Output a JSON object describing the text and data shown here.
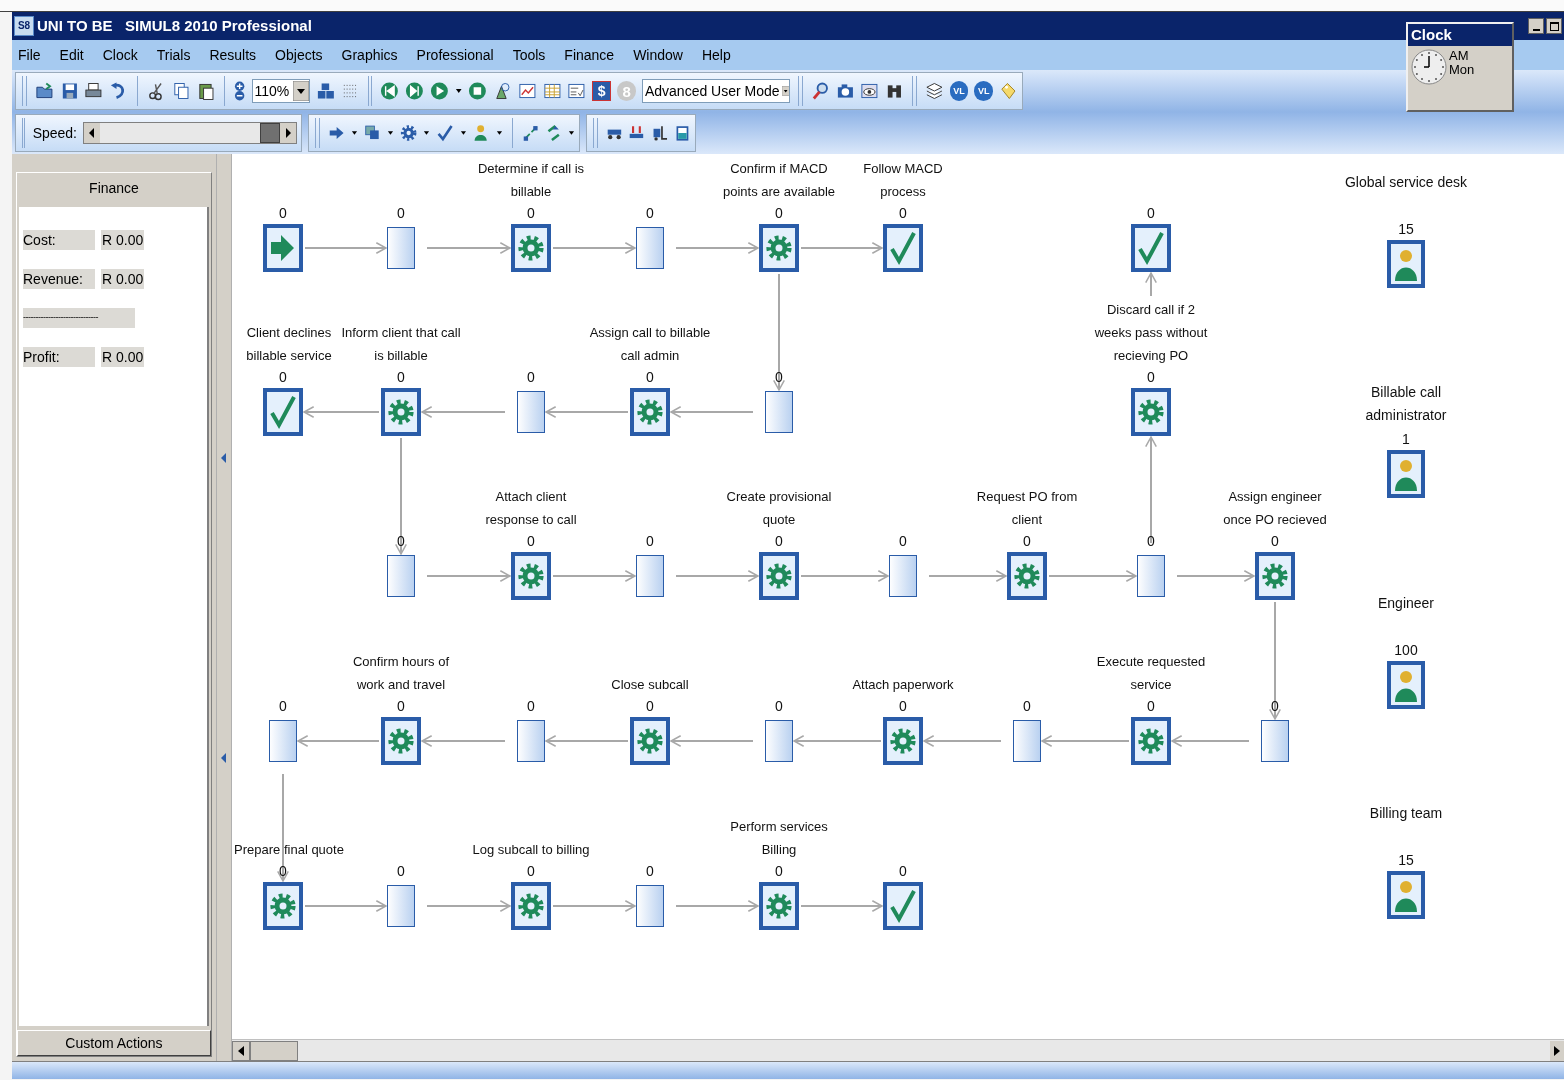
{
  "window": {
    "app_icon": "S8",
    "title": "UNI TO BE   SIMUL8 2010 Professional"
  },
  "menu": [
    "File",
    "Edit",
    "Clock",
    "Trials",
    "Results",
    "Objects",
    "Graphics",
    "Professional",
    "Tools",
    "Finance",
    "Window",
    "Help"
  ],
  "toolbar": {
    "zoom": "110%",
    "dollar_glyph": "$",
    "eight_glyph": "8",
    "mode": "Advanced User Mode",
    "vl_glyphs": [
      "VL",
      "VL"
    ]
  },
  "speed": {
    "label": "Speed:",
    "level": 1
  },
  "clock": {
    "title": "Clock",
    "period": "AM",
    "day": "Mon"
  },
  "finance": {
    "title": "Finance",
    "rows": [
      {
        "kind": "pair",
        "label": "Cost:",
        "value": "R 0.00"
      },
      {
        "kind": "pair",
        "label": "Revenue:",
        "value": "R 0.00"
      },
      {
        "kind": "rule",
        "label": "------------------------------"
      },
      {
        "kind": "pair",
        "label": "Profit:",
        "value": "R 0.00"
      }
    ],
    "button": "Custom Actions"
  },
  "rows": [
    {
      "nodes": [
        {
          "kind": "start",
          "count": "0"
        },
        {
          "kind": "queue",
          "count": "0"
        },
        {
          "kind": "activity",
          "label": "Determine if call is billable",
          "count": "0"
        },
        {
          "kind": "queue",
          "count": "0"
        },
        {
          "kind": "activity",
          "label": "Confirm if MACD points are available",
          "count": "0"
        },
        {
          "kind": "end",
          "label": "Follow MACD process",
          "count": "0"
        },
        {
          "kind": "end",
          "count": "0"
        }
      ]
    },
    {
      "nodes": [
        {
          "kind": "end",
          "label": "Client declines billable service",
          "count": "0"
        },
        {
          "kind": "activity",
          "label": "Inform client that call is billable",
          "count": "0"
        },
        {
          "kind": "queue",
          "count": "0"
        },
        {
          "kind": "activity",
          "label": "Assign call to billable call admin",
          "count": "0"
        },
        {
          "kind": "queue",
          "count": "0"
        },
        {
          "kind": "activity",
          "label": "Discard call if 2 weeks pass without recieving PO",
          "count": "0"
        }
      ]
    },
    {
      "nodes": [
        {
          "kind": "queue",
          "count": "0"
        },
        {
          "kind": "activity",
          "label": "Attach client response to call",
          "count": "0"
        },
        {
          "kind": "queue",
          "count": "0"
        },
        {
          "kind": "activity",
          "label": "Create provisional quote",
          "count": "0"
        },
        {
          "kind": "queue",
          "count": "0"
        },
        {
          "kind": "activity",
          "label": "Request PO from client",
          "count": "0"
        },
        {
          "kind": "queue",
          "count": "0"
        },
        {
          "kind": "activity",
          "label": "Assign engineer once PO recieved",
          "count": "0"
        }
      ]
    },
    {
      "nodes": [
        {
          "kind": "queue",
          "count": "0"
        },
        {
          "kind": "activity",
          "label": "Confirm hours of work and travel",
          "count": "0"
        },
        {
          "kind": "queue",
          "count": "0"
        },
        {
          "kind": "activity",
          "label": "Close subcall",
          "count": "0"
        },
        {
          "kind": "queue",
          "count": "0"
        },
        {
          "kind": "activity",
          "label": "Attach paperwork",
          "count": "0"
        },
        {
          "kind": "queue",
          "count": "0"
        },
        {
          "kind": "activity",
          "label": "Execute requested service",
          "count": "0"
        },
        {
          "kind": "queue",
          "count": "0"
        }
      ]
    },
    {
      "nodes": [
        {
          "kind": "activity",
          "label": "Prepare final quote",
          "count": "0"
        },
        {
          "kind": "queue",
          "count": "0"
        },
        {
          "kind": "activity",
          "label": "Log subcall to billing",
          "count": "0"
        },
        {
          "kind": "queue",
          "count": "0"
        },
        {
          "kind": "activity",
          "label": "Perform services Billing",
          "count": "0"
        },
        {
          "kind": "end",
          "count": "0"
        }
      ]
    }
  ],
  "resources": [
    {
      "label": "Global service desk",
      "count": "15"
    },
    {
      "label": "Billable call administrator",
      "count": "1"
    },
    {
      "label": "Engineer",
      "count": "100"
    },
    {
      "label": "Billing team",
      "count": "15"
    }
  ]
}
